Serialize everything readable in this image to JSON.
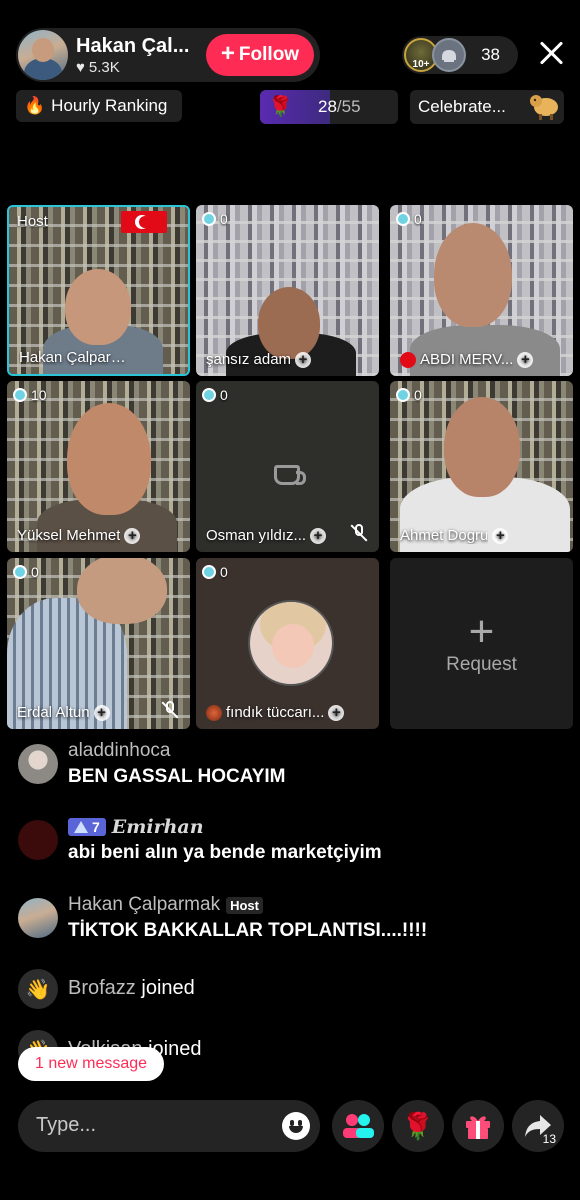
{
  "header": {
    "host_name": "Hakan Çal...",
    "likes": "5.3K",
    "follow_label": "Follow",
    "viewer_badge": "10+",
    "viewer_count": "38"
  },
  "subbar": {
    "ranking_label": "Hourly Ranking",
    "goal_current": "28",
    "goal_total": "/55",
    "goal_fraction": 0.51,
    "celebrate_label": "Celebrate..."
  },
  "grid": [
    {
      "label": "Host",
      "name": "Hakan Çalparmak"
    },
    {
      "score": "0",
      "name": "şansız adam"
    },
    {
      "score": "0",
      "name": "ABDI MERV..."
    },
    {
      "score": "10",
      "name": "Yüksel Mehmet"
    },
    {
      "score": "0",
      "name": "Osman yıldız..."
    },
    {
      "score": "0",
      "name": "Ahmet Dogru"
    },
    {
      "score": "0",
      "name": "Erdal Altun"
    },
    {
      "score": "0",
      "name": "fındık tüccarı..."
    },
    {
      "request_label": "Request"
    }
  ],
  "chat": [
    {
      "user": "aladdinhoca",
      "text": "BEN GASSAL HOCAYIM"
    },
    {
      "level": "7",
      "user": "Emirhan",
      "text": "abi beni alın ya bende marketçiyim"
    },
    {
      "user": "Hakan Çalparmak",
      "tag": "Host",
      "text": "TİKTOK BAKKALLAR TOPLANTISI....!!!!"
    },
    {
      "user": "Brofazz",
      "text": "joined"
    },
    {
      "user": "Volkisan",
      "text": "joined"
    }
  ],
  "new_message_label": "1 new message",
  "bottom": {
    "placeholder": "Type...",
    "share_count": "13"
  },
  "colors": {
    "follow": "#fe2c55",
    "host_border": "#2cc5d8",
    "goal_fill": "#5a2bb0"
  }
}
